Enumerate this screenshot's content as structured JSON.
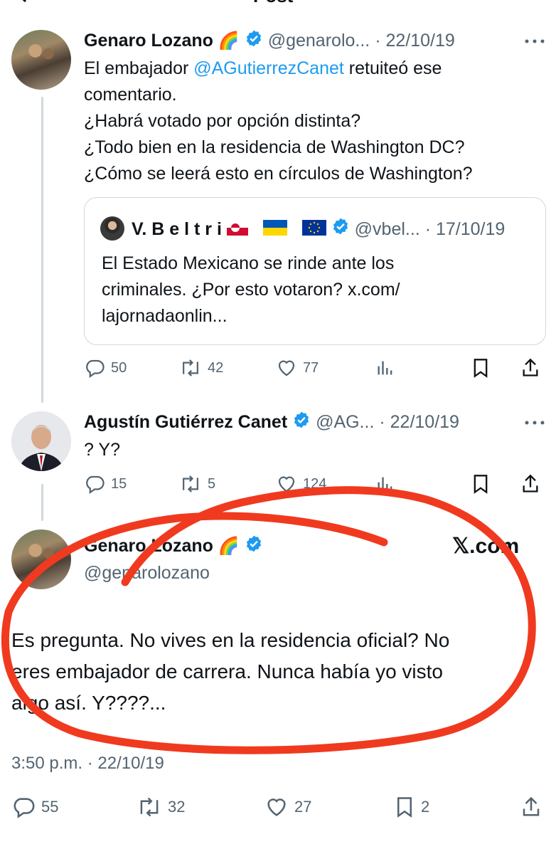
{
  "top_partial": "Post",
  "tweet1": {
    "name": "Genaro Lozano",
    "name_emoji": "🌈",
    "handle": "@genarolo...",
    "date": "· 22/10/19",
    "lines_a": "El embajador ",
    "mention": "@AGutierrezCanet",
    "lines_b": " retuiteó ese",
    "line2": "comentario.",
    "line3": "¿Habrá votado por opción distinta?",
    "line4": "¿Todo bien en la residencia de Washington DC?",
    "line5": "¿Cómo se leerá esto en círculos de Washington?",
    "quote": {
      "name": "V. B e l t r i",
      "handle": "@vbel...",
      "date": "· 17/10/19",
      "line1": "El Estado Mexicano se rinde ante los",
      "line2": "criminales. ¿Por esto votaron? x.com/",
      "line3": "lajornadaonlin..."
    },
    "replies": "50",
    "reposts": "42",
    "likes": "77"
  },
  "tweet2": {
    "name": "Agustín Gutiérrez Canet",
    "handle": "@AG...",
    "date": "· 22/10/19",
    "text": "? Y?",
    "replies": "15",
    "reposts": "5",
    "likes": "124"
  },
  "tweet3": {
    "name": "Genaro Lozano",
    "name_emoji": "🌈",
    "handle": "@genarolozano",
    "brand": "𝕏.com",
    "line1": "Es pregunta. No vives en la residencia oficial? No",
    "line2": "eres embajador de carrera. Nunca había yo visto",
    "line3": "algo así. Y????...",
    "timestamp": "3:50 p.m. · 22/10/19",
    "replies": "55",
    "reposts": "32",
    "likes": "27",
    "bookmarks": "2"
  },
  "colors": {
    "accent": "#1d9bf0",
    "text": "#0f1419",
    "muted": "#536471",
    "annotation": "#f03a1f"
  }
}
